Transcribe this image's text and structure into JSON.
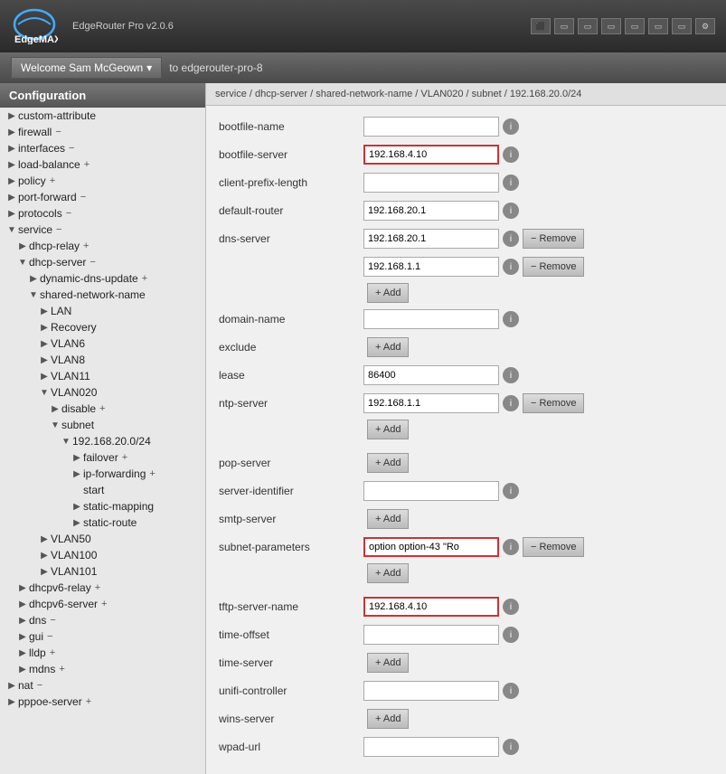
{
  "topbar": {
    "app_name": "EdgeMAX",
    "version": "EdgeRouter Pro v2.0.6",
    "icons": [
      "monitor",
      "rect1",
      "rect2",
      "rect3",
      "rect4",
      "rect5",
      "rect6",
      "gear"
    ]
  },
  "navbar": {
    "welcome": "Welcome Sam McGeown",
    "dropdown_arrow": "▾",
    "to_label": "to edgerouter-pro-8"
  },
  "sidebar": {
    "title": "Configuration",
    "items": [
      {
        "id": "custom-attribute",
        "label": "custom-attribute",
        "level": 0,
        "arrow": "▶",
        "action": ""
      },
      {
        "id": "firewall",
        "label": "firewall",
        "level": 0,
        "arrow": "▶",
        "action": "−"
      },
      {
        "id": "interfaces",
        "label": "interfaces",
        "level": 0,
        "arrow": "▶",
        "action": "−"
      },
      {
        "id": "load-balance",
        "label": "load-balance",
        "level": 0,
        "arrow": "▶",
        "action": "+"
      },
      {
        "id": "policy",
        "label": "policy",
        "level": 0,
        "arrow": "▶",
        "action": "+"
      },
      {
        "id": "port-forward",
        "label": "port-forward",
        "level": 0,
        "arrow": "▶",
        "action": "−"
      },
      {
        "id": "protocols",
        "label": "protocols",
        "level": 0,
        "arrow": "▶",
        "action": "−"
      },
      {
        "id": "service",
        "label": "service",
        "level": 0,
        "arrow": "▼",
        "action": "−"
      },
      {
        "id": "dhcp-relay",
        "label": "dhcp-relay",
        "level": 1,
        "arrow": "▶",
        "action": "+"
      },
      {
        "id": "dhcp-server",
        "label": "dhcp-server",
        "level": 1,
        "arrow": "▼",
        "action": "−"
      },
      {
        "id": "dynamic-dns-update",
        "label": "dynamic-dns-update",
        "level": 2,
        "arrow": "▶",
        "action": "+"
      },
      {
        "id": "shared-network-name",
        "label": "shared-network-name",
        "level": 2,
        "arrow": "▼",
        "action": ""
      },
      {
        "id": "LAN",
        "label": "LAN",
        "level": 3,
        "arrow": "▶",
        "action": ""
      },
      {
        "id": "Recovery",
        "label": "Recovery",
        "level": 3,
        "arrow": "▶",
        "action": ""
      },
      {
        "id": "VLAN6",
        "label": "VLAN6",
        "level": 3,
        "arrow": "▶",
        "action": ""
      },
      {
        "id": "VLAN8",
        "label": "VLAN8",
        "level": 3,
        "arrow": "▶",
        "action": ""
      },
      {
        "id": "VLAN11",
        "label": "VLAN11",
        "level": 3,
        "arrow": "▶",
        "action": ""
      },
      {
        "id": "VLAN020",
        "label": "VLAN020",
        "level": 3,
        "arrow": "▼",
        "action": ""
      },
      {
        "id": "disable",
        "label": "disable",
        "level": 4,
        "arrow": "▶",
        "action": "+"
      },
      {
        "id": "subnet",
        "label": "subnet",
        "level": 4,
        "arrow": "▼",
        "action": ""
      },
      {
        "id": "192.168.20.0/24",
        "label": "192.168.20.0/24",
        "level": 5,
        "arrow": "▼",
        "action": ""
      },
      {
        "id": "failover",
        "label": "failover",
        "level": 6,
        "arrow": "▶",
        "action": "+"
      },
      {
        "id": "ip-forwarding",
        "label": "ip-forwarding",
        "level": 6,
        "arrow": "▶",
        "action": "+"
      },
      {
        "id": "start",
        "label": "start",
        "level": 6,
        "arrow": "",
        "action": ""
      },
      {
        "id": "static-mapping",
        "label": "static-mapping",
        "level": 6,
        "arrow": "▶",
        "action": ""
      },
      {
        "id": "static-route",
        "label": "static-route",
        "level": 6,
        "arrow": "▶",
        "action": ""
      },
      {
        "id": "VLAN50",
        "label": "VLAN50",
        "level": 3,
        "arrow": "▶",
        "action": ""
      },
      {
        "id": "VLAN100",
        "label": "VLAN100",
        "level": 3,
        "arrow": "▶",
        "action": ""
      },
      {
        "id": "VLAN101",
        "label": "VLAN101",
        "level": 3,
        "arrow": "▶",
        "action": ""
      },
      {
        "id": "dhcpv6-relay",
        "label": "dhcpv6-relay",
        "level": 1,
        "arrow": "▶",
        "action": "+"
      },
      {
        "id": "dhcpv6-server",
        "label": "dhcpv6-server",
        "level": 1,
        "arrow": "▶",
        "action": "+"
      },
      {
        "id": "dns",
        "label": "dns",
        "level": 1,
        "arrow": "▶",
        "action": "−"
      },
      {
        "id": "gui",
        "label": "gui",
        "level": 1,
        "arrow": "▶",
        "action": "−"
      },
      {
        "id": "lldp",
        "label": "lldp",
        "level": 1,
        "arrow": "▶",
        "action": "+"
      },
      {
        "id": "mdns",
        "label": "mdns",
        "level": 1,
        "arrow": "▶",
        "action": "+"
      },
      {
        "id": "nat",
        "label": "nat",
        "level": 0,
        "arrow": "▶",
        "action": "−"
      },
      {
        "id": "pppoe-server",
        "label": "pppoe-server",
        "level": 0,
        "arrow": "▶",
        "action": "+"
      }
    ]
  },
  "content": {
    "breadcrumb": "service / dhcp-server / shared-network-name / VLAN020 / subnet / 192.168.20.0/24",
    "fields": [
      {
        "id": "bootfile-name",
        "label": "bootfile-name",
        "type": "input",
        "value": "",
        "highlighted": false
      },
      {
        "id": "bootfile-server",
        "label": "bootfile-server",
        "type": "input",
        "value": "192.168.4.10",
        "highlighted": true
      },
      {
        "id": "client-prefix-length",
        "label": "client-prefix-length",
        "type": "input",
        "value": "",
        "highlighted": false
      },
      {
        "id": "default-router",
        "label": "default-router",
        "type": "input",
        "value": "192.168.20.1",
        "highlighted": false
      },
      {
        "id": "dns-server-1",
        "label": "dns-server",
        "type": "input-remove",
        "value": "192.168.20.1",
        "highlighted": false
      },
      {
        "id": "dns-server-2",
        "label": "",
        "type": "input-remove",
        "value": "192.168.1.1",
        "highlighted": false
      },
      {
        "id": "dns-server-add",
        "label": "",
        "type": "add",
        "value": ""
      },
      {
        "id": "domain-name",
        "label": "domain-name",
        "type": "input",
        "value": "",
        "highlighted": false
      },
      {
        "id": "exclude",
        "label": "exclude",
        "type": "add-only",
        "value": ""
      },
      {
        "id": "lease",
        "label": "lease",
        "type": "input",
        "value": "86400",
        "highlighted": false
      },
      {
        "id": "ntp-server",
        "label": "ntp-server",
        "type": "input-remove",
        "value": "192.168.1.1",
        "highlighted": false
      },
      {
        "id": "ntp-add",
        "label": "",
        "type": "add",
        "value": ""
      },
      {
        "id": "pop-server",
        "label": "pop-server",
        "type": "add-only",
        "value": ""
      },
      {
        "id": "server-identifier",
        "label": "server-identifier",
        "type": "input",
        "value": "",
        "highlighted": false
      },
      {
        "id": "smtp-server",
        "label": "smtp-server",
        "type": "add-only",
        "value": ""
      },
      {
        "id": "subnet-parameters",
        "label": "subnet-parameters",
        "type": "input-remove",
        "value": "option option-43 &quot;Ro",
        "highlighted": true
      },
      {
        "id": "subnet-parameters-add",
        "label": "",
        "type": "add",
        "value": ""
      },
      {
        "id": "tftp-server-name",
        "label": "tftp-server-name",
        "type": "input",
        "value": "192.168.4.10",
        "highlighted": true
      },
      {
        "id": "time-offset",
        "label": "time-offset",
        "type": "input",
        "value": "",
        "highlighted": false
      },
      {
        "id": "time-server",
        "label": "time-server",
        "type": "add-only",
        "value": ""
      },
      {
        "id": "unifi-controller",
        "label": "unifi-controller",
        "type": "input",
        "value": "",
        "highlighted": false
      },
      {
        "id": "wins-server",
        "label": "wins-server",
        "type": "add-only",
        "value": ""
      },
      {
        "id": "wpad-url",
        "label": "wpad-url",
        "type": "input",
        "value": "",
        "highlighted": false
      }
    ],
    "buttons": {
      "add": "+ Add",
      "remove": "− Remove",
      "info": "i"
    }
  }
}
